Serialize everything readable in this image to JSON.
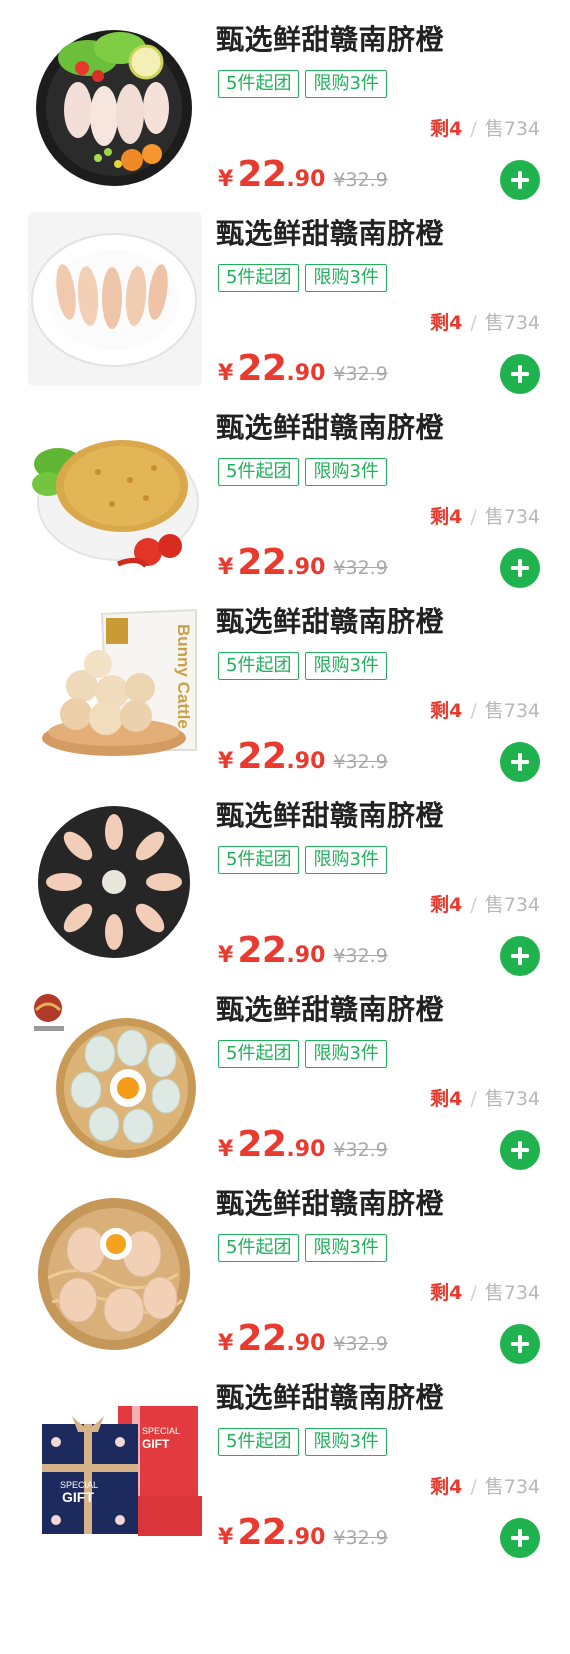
{
  "products": [
    {
      "image": "chicken-breast-plate-image",
      "title": "甄选鲜甜赣南脐橙",
      "tags": [
        "5件起团",
        "限购3件"
      ],
      "stock_left": "剩4",
      "sold": "售734",
      "price_yen": "¥",
      "price_int": "22",
      "price_dec": ".90",
      "price_orig": "¥32.9"
    },
    {
      "image": "chicken-fillet-plate-image",
      "title": "甄选鲜甜赣南脐橙",
      "tags": [
        "5件起团",
        "限购3件"
      ],
      "stock_left": "剩4",
      "sold": "售734",
      "price_yen": "¥",
      "price_int": "22",
      "price_dec": ".90",
      "price_orig": "¥32.9"
    },
    {
      "image": "breaded-cutlet-image",
      "title": "甄选鲜甜赣南脐橙",
      "tags": [
        "5件起团",
        "限购3件"
      ],
      "stock_left": "剩4",
      "sold": "售734",
      "price_yen": "¥",
      "price_int": "22",
      "price_dec": ".90",
      "price_orig": "¥32.9"
    },
    {
      "image": "beef-balls-bag-image",
      "title": "甄选鲜甜赣南脐橙",
      "tags": [
        "5件起团",
        "限购3件"
      ],
      "stock_left": "剩4",
      "sold": "售734",
      "price_yen": "¥",
      "price_int": "22",
      "price_dec": ".90",
      "price_orig": "¥32.9"
    },
    {
      "image": "chicken-drumettes-plate-image",
      "title": "甄选鲜甜赣南脐橙",
      "tags": [
        "5件起团",
        "限购3件"
      ],
      "stock_left": "剩4",
      "sold": "售734",
      "price_yen": "¥",
      "price_int": "22",
      "price_dec": ".90",
      "price_orig": "¥32.9"
    },
    {
      "image": "duck-eggs-basket-image",
      "title": "甄选鲜甜赣南脐橙",
      "tags": [
        "5件起团",
        "限购3件"
      ],
      "stock_left": "剩4",
      "sold": "售734",
      "price_yen": "¥",
      "price_int": "22",
      "price_dec": ".90",
      "price_orig": "¥32.9"
    },
    {
      "image": "chicken-eggs-basket-image",
      "title": "甄选鲜甜赣南脐橙",
      "tags": [
        "5件起团",
        "限购3件"
      ],
      "stock_left": "剩4",
      "sold": "售734",
      "price_yen": "¥",
      "price_int": "22",
      "price_dec": ".90",
      "price_orig": "¥32.9"
    },
    {
      "image": "gift-box-image",
      "title": "甄选鲜甜赣南脐橙",
      "tags": [
        "5件起团",
        "限购3件"
      ],
      "stock_left": "剩4",
      "sold": "售734",
      "price_yen": "¥",
      "price_int": "22",
      "price_dec": ".90",
      "price_orig": "¥32.9"
    }
  ],
  "gift_box_text": {
    "line1": "SPECIAL",
    "line2": "GIFT",
    "line3": "SPECIAL",
    "line4": "GIFT"
  },
  "beef_bag_brand": "Bunny Cattle",
  "colors": {
    "accent_red": "#e83a2f",
    "tag_green": "#20b25a",
    "add_button_green": "#1fb24e",
    "muted_gray": "#b8b8b8"
  },
  "icons": {
    "add": "plus-circle-icon"
  }
}
